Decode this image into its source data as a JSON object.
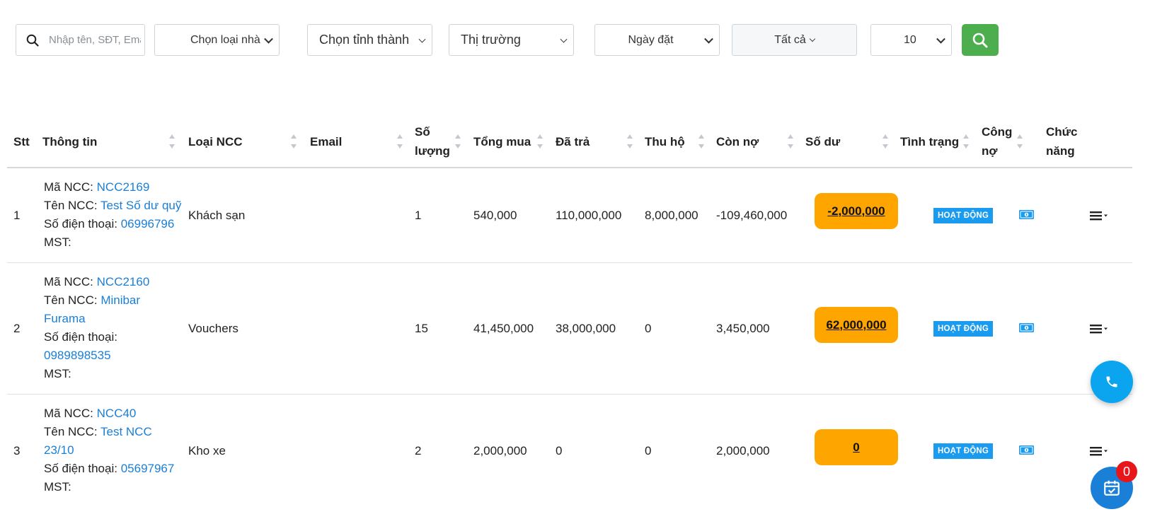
{
  "filters": {
    "search_placeholder": "Nhập tên, SĐT, Email",
    "supplier_type": "Chọn loại nhà",
    "province": "Chọn tỉnh thành",
    "market": "Thị trường",
    "date_field": "Ngày đặt",
    "status": "Tất cả",
    "page_size": "10",
    "search_button_color": "#4cae4c"
  },
  "table": {
    "columns": {
      "stt": "Stt",
      "info": "Thông tin",
      "type": "Loại NCC",
      "email": "Email",
      "qty_1": "Số",
      "qty_2": "lượng",
      "total": "Tổng mua",
      "paid": "Đã trả",
      "collected": "Thu hộ",
      "owed": "Còn nợ",
      "balance": "Số dư",
      "status": "Tình trạng",
      "debt_1": "Công",
      "debt_2": "nợ",
      "actions_1": "Chức",
      "actions_2": "năng"
    },
    "labels": {
      "code": "Mã NCC:",
      "name": "Tên NCC:",
      "phone": "Số điện thoại:",
      "tax": "MST:"
    },
    "rows": [
      {
        "stt": "1",
        "code": "NCC2169",
        "name": "Test Số dư quỹ",
        "phone": "06996796",
        "type": "Khách sạn",
        "email": "",
        "qty": "1",
        "total": "540,000",
        "paid": "110,000,000",
        "collected": "8,000,000",
        "owed": "-109,460,000",
        "balance": "-2,000,000",
        "status": "HOẠT ĐỘNG"
      },
      {
        "stt": "2",
        "code": "NCC2160",
        "name_1": "Minibar",
        "name_2": "Furama",
        "phone": "0989898535",
        "type": "Vouchers",
        "email": "",
        "qty": "15",
        "total": "41,450,000",
        "paid": "38,000,000",
        "collected": "0",
        "owed": "3,450,000",
        "balance": "62,000,000",
        "status": "HOẠT ĐỘNG"
      },
      {
        "stt": "3",
        "code": "NCC40",
        "name_1": "Test NCC",
        "name_2": "23/10",
        "phone": "05697967",
        "type": "Kho xe",
        "email": "",
        "qty": "2",
        "total": "2,000,000",
        "paid": "0",
        "collected": "0",
        "owed": "2,000,000",
        "balance": "0",
        "status": "HOẠT ĐỘNG"
      }
    ]
  },
  "floating": {
    "calendar_count": "0"
  },
  "colors": {
    "link": "#1a7fd6",
    "balance_bg": "#ffa500",
    "status_badge": "#1a9bf0",
    "phone_fab": "#0aa4ef",
    "notification": "#e8161b"
  },
  "icons": {
    "search": "search-icon",
    "debt": "money-icon",
    "actions": "menu-icon",
    "phone": "phone-icon",
    "calendar": "calendar-check-icon"
  }
}
